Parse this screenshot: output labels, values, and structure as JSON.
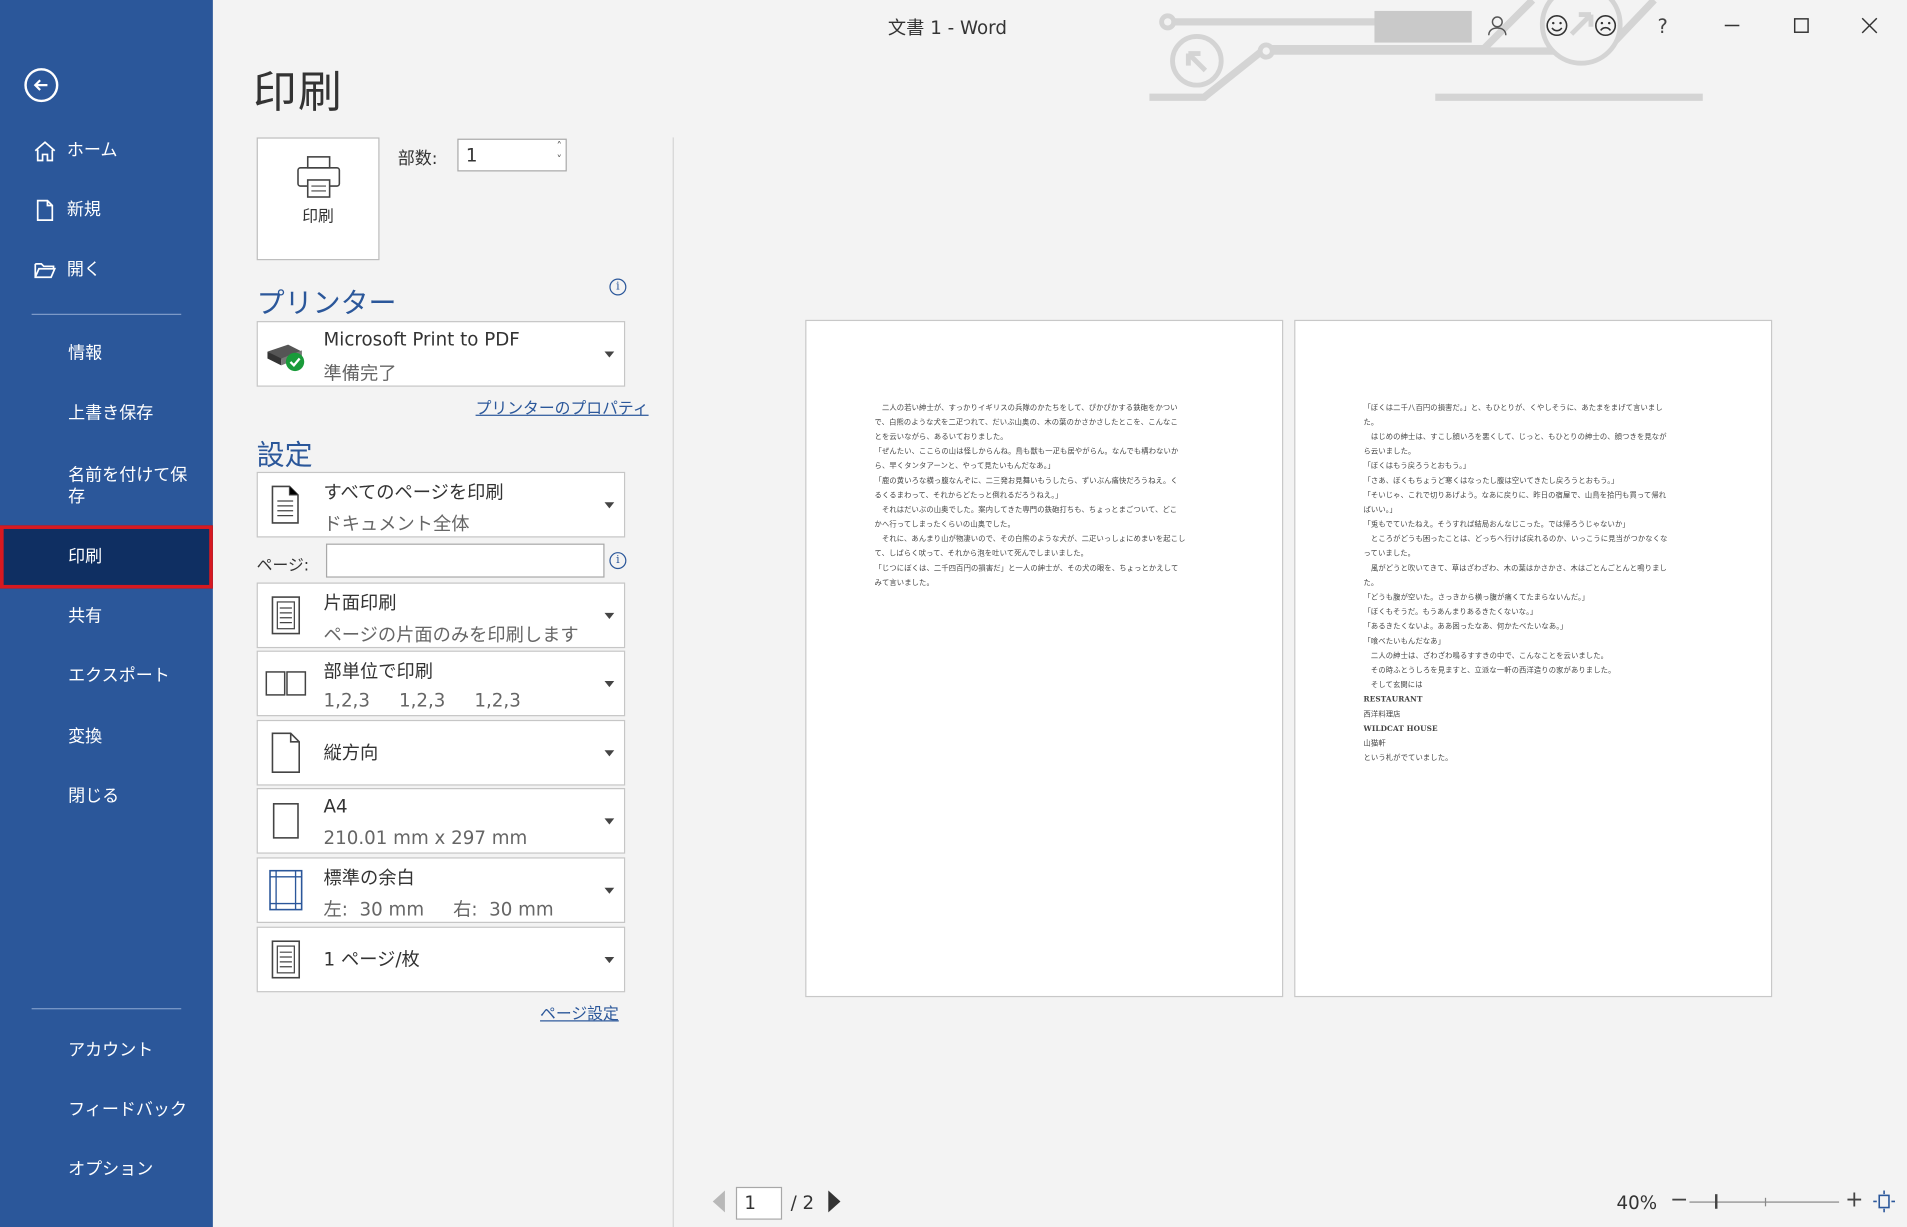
{
  "window": {
    "title": "文書 1  -  Word",
    "help_label": "?"
  },
  "sidebar": {
    "top_items": [
      {
        "label": "ホーム",
        "icon": "home-icon"
      },
      {
        "label": "新規",
        "icon": "new-document-icon"
      },
      {
        "label": "開く",
        "icon": "folder-open-icon"
      }
    ],
    "middle_items": [
      {
        "label": "情報"
      },
      {
        "label": "上書き保存"
      },
      {
        "label": "名前を付けて保存"
      },
      {
        "label": "印刷",
        "active": true
      },
      {
        "label": "共有"
      },
      {
        "label": "エクスポート"
      },
      {
        "label": "変換"
      },
      {
        "label": "閉じる"
      }
    ],
    "bottom_items": [
      {
        "label": "アカウント"
      },
      {
        "label": "フィードバック"
      },
      {
        "label": "オプション"
      }
    ]
  },
  "print": {
    "heading": "印刷",
    "print_button_label": "印刷",
    "copies_label": "部数:",
    "copies_value": "1",
    "printer_heading": "プリンター",
    "printer": {
      "name": "Microsoft Print to PDF",
      "status": "準備完了"
    },
    "printer_properties_link": "プリンターのプロパティ",
    "settings_heading": "設定",
    "settings": {
      "pages_scope": {
        "title": "すべてのページを印刷",
        "subtitle": "ドキュメント全体"
      },
      "pages_label": "ページ:",
      "pages_value": "",
      "sides": {
        "title": "片面印刷",
        "subtitle": "ページの片面のみを印刷します"
      },
      "collation": {
        "title": "部単位で印刷",
        "subtitle": "1,2,3     1,2,3     1,2,3"
      },
      "orientation": {
        "title": "縦方向"
      },
      "paper": {
        "title": "A4",
        "subtitle": "210.01 mm x 297 mm"
      },
      "margins": {
        "title": "標準の余白",
        "subtitle": "左:  30 mm     右:  30 mm"
      },
      "pages_per_sheet": {
        "title": "1 ページ/枚"
      }
    },
    "page_setup_link": "ページ設定"
  },
  "preview": {
    "page1_lines": [
      "　二人の若い紳士が、すっかりイギリスの兵隊のかたちをして、ぴかぴかする鉄砲をかつい",
      "で、白熊のような犬を二疋つれて、だいぶ山奥の、木の葉のかさかさしたとこを、こんなこ",
      "とを云いながら、あるいておりました。",
      "「ぜんたい、ここらの山は怪しからんね。鳥も獣も一疋も居やがらん。なんでも構わないか",
      "ら、早くタンタアーンと、やって見たいもんだなあ。」",
      "「鹿の黄いろな横っ腹なんぞに、二三発お見舞いもうしたら、ずいぶん痛快だろうねえ。く",
      "るくるまわって、それからどたっと倒れるだろうねえ。」",
      "　それはだいぶの山奥でした。案内してきた専門の鉄砲打ちも、ちょっとまごついて、どこ",
      "かへ行ってしまったくらいの山奥でした。",
      "　それに、あんまり山が物凄いので、その白熊のような犬が、二疋いっしょにめまいを起こし",
      "て、しばらく吠って、それから泡を吐いて死んでしまいました。",
      "「じつにぼくは、二千四百円の損害だ」と一人の紳士が、その犬の眼を、ちょっとかえして",
      "みて言いました。"
    ],
    "page2_lines": [
      "「ぼくは二千八百円の損害だ。」と、もひとりが、くやしそうに、あたまをまげて言いまし",
      "た。",
      "　はじめの紳士は、すこし顔いろを悪くして、じっと、もひとりの紳士の、顔つきを見なが",
      "ら云いました。",
      "「ぼくはもう戻ろうとおもう。」",
      "「さあ、ぼくもちょうど寒くはなったし腹は空いてきたし戻ろうとおもう。」",
      "「そいじゃ、これで切りあげよう。なあに戻りに、昨日の宿屋で、山鳥を拾円も買って帰れ",
      "ばいい。」",
      "「兎もでていたねえ。そうすれば結局おんなじこった。では帰ろうじゃないか」",
      "　ところがどうも困ったことは、どっちへ行けば戻れるのか、いっこうに見当がつかなくな",
      "っていました。",
      "　風がどうと吹いてきて、草はざわざわ、木の葉はかさかさ、木はごとんごとんと鳴りまし",
      "た。",
      "「どうも腹が空いた。さっきから横っ腹が痛くてたまらないんだ。」",
      "「ぼくもそうだ。もうあんまりあるきたくないな。」",
      "「あるきたくないよ。ああ困ったなあ、何かたべたいなあ。」",
      "「喰べたいもんだなあ」",
      "　二人の紳士は、ざわざわ鳴るすすきの中で、こんなことを云いました。",
      "　その時ふとうしろを見ますと、立派な一軒の西洋造りの家がありました。",
      "　そして玄関には",
      "RESTAURANT",
      "西洋料理店",
      "WILDCAT HOUSE",
      "山猫軒",
      "という札がでていました。"
    ]
  },
  "footer": {
    "page_value": "1",
    "page_total": "/ 2",
    "zoom": "40%",
    "zoom_level_percent": 40
  },
  "colors": {
    "sidebar_bg": "#2b579a",
    "active_bg": "#0f2f62",
    "active_border": "#d71920",
    "accent": "#2b579a"
  }
}
